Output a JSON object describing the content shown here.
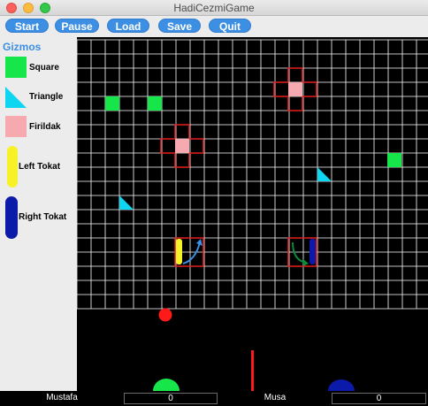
{
  "window": {
    "title": "HadiCezmiGame"
  },
  "toolbar": {
    "start": "Start",
    "pause": "Pause",
    "load": "Load",
    "save": "Save",
    "quit": "Quit"
  },
  "sidebar": {
    "title": "Gizmos",
    "items": [
      {
        "label": "Square",
        "color": "#17e64a",
        "icon": "square-icon"
      },
      {
        "label": "Triangle",
        "color": "#0fd6f0",
        "icon": "triangle-icon"
      },
      {
        "label": "Firildak",
        "color": "#f6aab0",
        "icon": "firildak-icon"
      },
      {
        "label": "Left Tokat",
        "color": "#f7f227",
        "icon": "left-tokat-icon"
      },
      {
        "label": "Right Tokat",
        "color": "#0b1aa8",
        "icon": "right-tokat-icon"
      }
    ]
  },
  "board": {
    "background": "#000000",
    "grid_color": "#ffffff",
    "square_color": "#17e64a",
    "triangle_color": "#0fd6f0",
    "firildak_color": "#f6aab0",
    "frame_color": "#e32020",
    "ball_color": "#ff1a1a",
    "cannon_left_color": "#17e64a",
    "cannon_right_color": "#0b1aa8",
    "divider_color": "#ff1a1a"
  },
  "players": {
    "player1": {
      "name": "Mustafa",
      "score": "0"
    },
    "player2": {
      "name": "Musa",
      "score": "0"
    }
  }
}
